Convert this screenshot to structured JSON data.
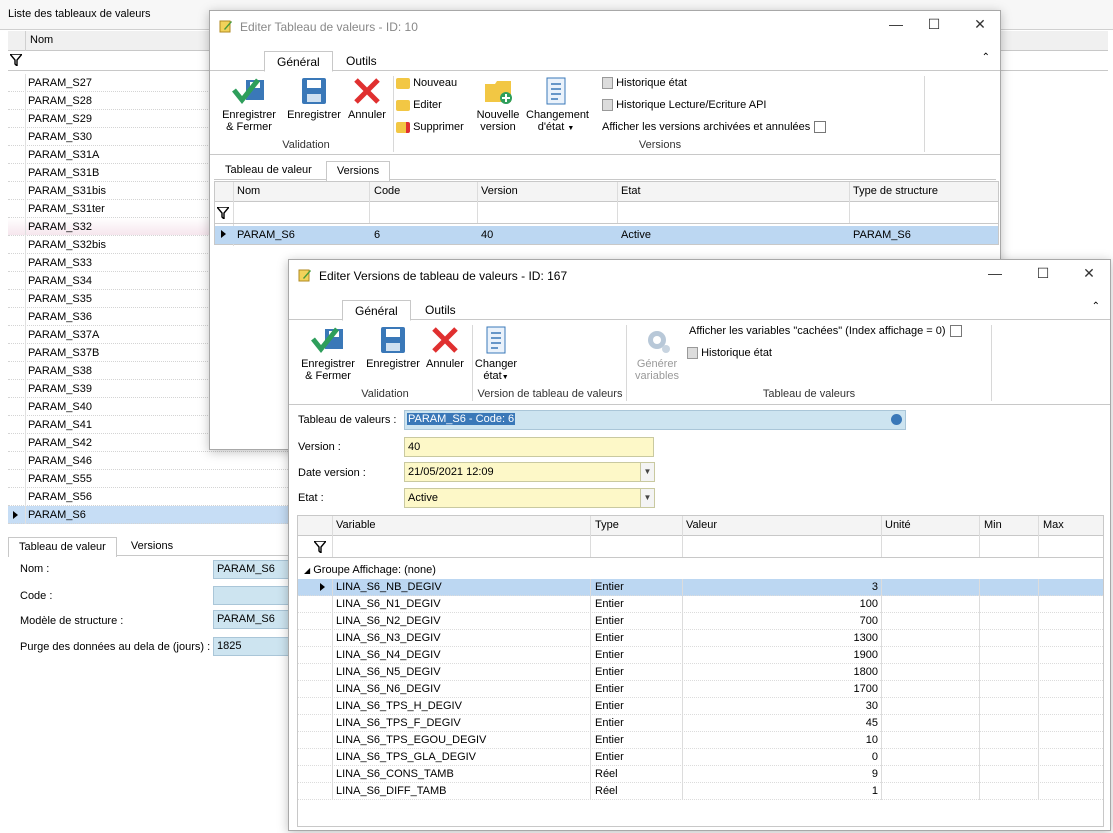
{
  "background": {
    "title": "Liste des tableaux de valeurs",
    "column_header": "Nom",
    "rows": [
      "PARAM_S27",
      "PARAM_S28",
      "PARAM_S29",
      "PARAM_S30",
      "PARAM_S31A",
      "PARAM_S31B",
      "PARAM_S31bis",
      "PARAM_S31ter",
      "PARAM_S32",
      "PARAM_S32bis",
      "PARAM_S33",
      "PARAM_S34",
      "PARAM_S35",
      "PARAM_S36",
      "PARAM_S37A",
      "PARAM_S37B",
      "PARAM_S38",
      "PARAM_S39",
      "PARAM_S40",
      "PARAM_S41",
      "PARAM_S42",
      "PARAM_S46",
      "PARAM_S55",
      "PARAM_S56",
      "PARAM_S6"
    ],
    "tabs": [
      "Tableau de valeur",
      "Versions"
    ],
    "form": {
      "nom_label": "Nom :",
      "nom_value": "PARAM_S6",
      "code_label": "Code :",
      "code_value": "",
      "modele_label": "Modèle de structure :",
      "modele_value": "PARAM_S6",
      "purge_label": "Purge des données au dela de (jours) :",
      "purge_value": "1825"
    }
  },
  "window1": {
    "title": "Editer Tableau de valeurs - ID: 10",
    "ribbon_tabs": [
      "Général",
      "Outils"
    ],
    "buttons": {
      "save_close": "Enregistrer & Fermer",
      "save": "Enregistrer",
      "cancel": "Annuler",
      "new": "Nouveau",
      "edit": "Editer",
      "delete": "Supprimer",
      "new_version": "Nouvelle version",
      "change_state": "Changement d'état",
      "history_state": "Historique état",
      "history_api": "Historique Lecture/Ecriture API",
      "show_archived": "Afficher les versions archivées et annulées"
    },
    "groups": {
      "validation": "Validation",
      "versions": "Versions"
    },
    "inner_tabs": [
      "Tableau de valeur",
      "Versions"
    ],
    "grid": {
      "columns": [
        "Nom",
        "Code",
        "Version",
        "Etat",
        "Type de structure"
      ],
      "rows": [
        {
          "nom": "PARAM_S6",
          "code": "6",
          "version": "40",
          "etat": "Active",
          "type": "PARAM_S6"
        }
      ]
    }
  },
  "window2": {
    "title": "Editer Versions de tableau de valeurs - ID: 167",
    "ribbon_tabs": [
      "Général",
      "Outils"
    ],
    "buttons": {
      "save_close": "Enregistrer & Fermer",
      "save": "Enregistrer",
      "cancel": "Annuler",
      "change_state": "Changer état",
      "generate": "Générer variables",
      "show_hidden": "Afficher les variables \"cachées\" (Index affichage = 0)",
      "history_state": "Historique état"
    },
    "groups": {
      "validation": "Validation",
      "version": "Version de tableau de valeurs",
      "tableau": "Tableau de valeurs"
    },
    "form": {
      "tableau_label": "Tableau de valeurs :",
      "tableau_value": "PARAM_S6 - Code: 6",
      "version_label": "Version :",
      "version_value": "40",
      "date_label": "Date version :",
      "date_value": "21/05/2021 12:09",
      "etat_label": "Etat :",
      "etat_value": "Active"
    },
    "grid": {
      "columns": [
        "Variable",
        "Type",
        "Valeur",
        "Unité",
        "Min",
        "Max"
      ],
      "group_label": "Groupe Affichage:  (none)",
      "rows": [
        {
          "variable": "LINA_S6_NB_DEGIV",
          "type": "Entier",
          "valeur": "3"
        },
        {
          "variable": "LINA_S6_N1_DEGIV",
          "type": "Entier",
          "valeur": "100"
        },
        {
          "variable": "LINA_S6_N2_DEGIV",
          "type": "Entier",
          "valeur": "700"
        },
        {
          "variable": "LINA_S6_N3_DEGIV",
          "type": "Entier",
          "valeur": "1300"
        },
        {
          "variable": "LINA_S6_N4_DEGIV",
          "type": "Entier",
          "valeur": "1900"
        },
        {
          "variable": "LINA_S6_N5_DEGIV",
          "type": "Entier",
          "valeur": "1800"
        },
        {
          "variable": "LINA_S6_N6_DEGIV",
          "type": "Entier",
          "valeur": "1700"
        },
        {
          "variable": "LINA_S6_TPS_H_DEGIV",
          "type": "Entier",
          "valeur": "30"
        },
        {
          "variable": "LINA_S6_TPS_F_DEGIV",
          "type": "Entier",
          "valeur": "45"
        },
        {
          "variable": "LINA_S6_TPS_EGOU_DEGIV",
          "type": "Entier",
          "valeur": "10"
        },
        {
          "variable": "LINA_S6_TPS_GLA_DEGIV",
          "type": "Entier",
          "valeur": "0"
        },
        {
          "variable": "LINA_S6_CONS_TAMB",
          "type": "Réel",
          "valeur": "9"
        },
        {
          "variable": "LINA_S6_DIFF_TAMB",
          "type": "Réel",
          "valeur": "1"
        }
      ]
    }
  },
  "colors": {
    "selection": "#bcd7f2",
    "input_yellow": "#fdf8c8",
    "input_blue": "#cde4f0",
    "save_green": "#2e9e5b",
    "cancel_red": "#e03030",
    "save_blue": "#3a78b8"
  }
}
